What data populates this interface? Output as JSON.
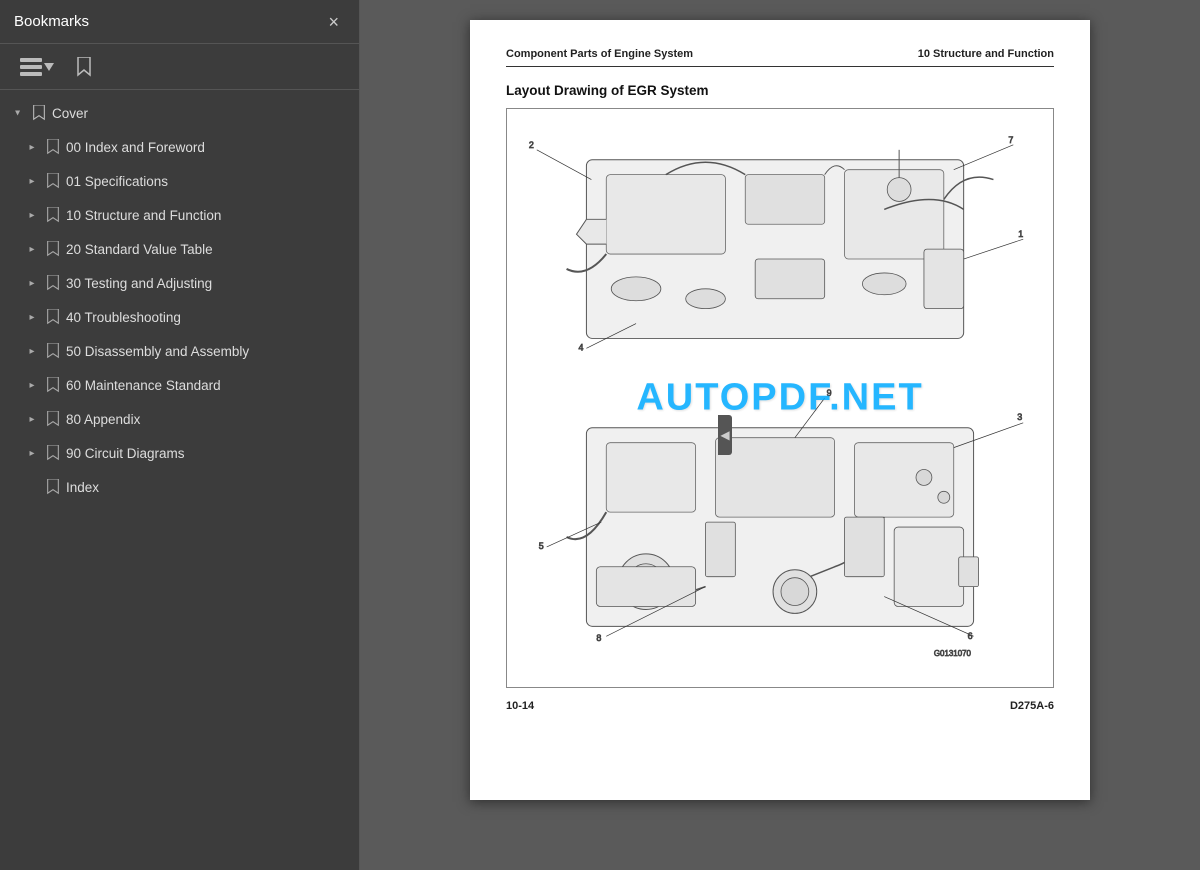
{
  "sidebar": {
    "title": "Bookmarks",
    "close_label": "×",
    "toolbar": {
      "list_icon": "≡",
      "bookmark_icon": "🔖"
    },
    "tree": [
      {
        "id": "cover",
        "level": 0,
        "expanded": true,
        "has_children": true,
        "label": "Cover"
      },
      {
        "id": "00",
        "level": 1,
        "expanded": false,
        "has_children": true,
        "label": "00 Index and Foreword"
      },
      {
        "id": "01",
        "level": 1,
        "expanded": false,
        "has_children": true,
        "label": "01 Specifications"
      },
      {
        "id": "10",
        "level": 1,
        "expanded": false,
        "has_children": true,
        "label": "10 Structure and Function"
      },
      {
        "id": "20",
        "level": 1,
        "expanded": false,
        "has_children": true,
        "label": "20 Standard Value Table"
      },
      {
        "id": "30",
        "level": 1,
        "expanded": false,
        "has_children": true,
        "label": "30 Testing and Adjusting"
      },
      {
        "id": "40",
        "level": 1,
        "expanded": false,
        "has_children": true,
        "label": "40 Troubleshooting"
      },
      {
        "id": "50",
        "level": 1,
        "expanded": false,
        "has_children": true,
        "label": "50 Disassembly and Assembly"
      },
      {
        "id": "60",
        "level": 1,
        "expanded": false,
        "has_children": true,
        "label": "60 Maintenance Standard"
      },
      {
        "id": "80",
        "level": 1,
        "expanded": false,
        "has_children": true,
        "label": "80 Appendix"
      },
      {
        "id": "90",
        "level": 1,
        "expanded": false,
        "has_children": true,
        "label": "90 Circuit Diagrams"
      },
      {
        "id": "index",
        "level": 1,
        "expanded": false,
        "has_children": false,
        "label": "Index"
      }
    ]
  },
  "page": {
    "header_left": "Component Parts of Engine System",
    "header_right": "10 Structure and Function",
    "section_title": "Layout Drawing of EGR System",
    "watermark": "AUTOPDF.NET",
    "footer_left": "10-14",
    "footer_right": "D275A-6",
    "diagram_ref": "G0131070"
  },
  "colors": {
    "sidebar_bg": "#3c3c3c",
    "main_bg": "#5a5a5a",
    "page_bg": "#ffffff",
    "watermark": "#00aaff",
    "text_dark": "#222222",
    "bookmark_color": "#cccccc"
  }
}
